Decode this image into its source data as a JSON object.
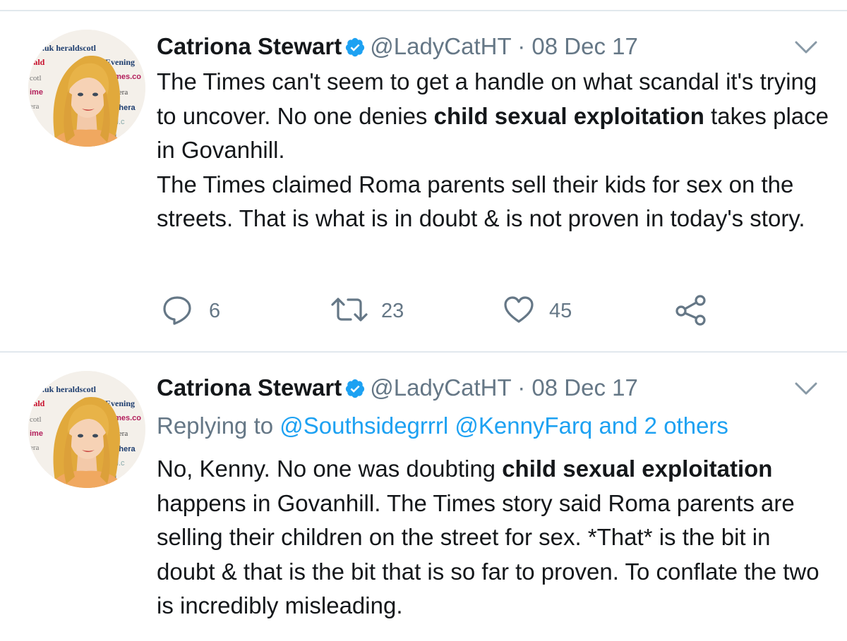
{
  "tweets": [
    {
      "author": {
        "name": "Catriona Stewart",
        "handle": "@LadyCatHT",
        "separator": "·",
        "date": "08 Dec 17",
        "verified": true
      },
      "text": {
        "p1_pre": "The Times can't seem to get a handle on what scandal it's trying to uncover. No one denies ",
        "p1_bold": "child sexual exploitation",
        "p1_post": " takes place in Govanhill.",
        "p2": "The Times claimed Roma parents sell their kids for sex on the streets. That is what is in doubt & is not proven in today's story."
      },
      "stats": {
        "replies": "6",
        "retweets": "23",
        "likes": "45"
      }
    },
    {
      "author": {
        "name": "Catriona Stewart",
        "handle": "@LadyCatHT",
        "separator": "·",
        "date": "08 Dec 17",
        "verified": true
      },
      "replying_to": {
        "prefix": "Replying to ",
        "mentions": "@Southsidegrrrl @KennyFarq and 2 others"
      },
      "text": {
        "p1_pre": "No, Kenny. No one was doubting ",
        "p1_bold": "child sexual exploitation",
        "p1_post": " happens in Govanhill. The Times story said Roma parents are selling their children on the street for sex. *That* is the bit in doubt & that is the bit that is so far to proven. To conflate the two is incredibly misleading."
      }
    }
  ],
  "avatar_background_text": [
    ".uk heraldscotl",
    "rald",
    "ld Evening",
    "cotl",
    "ingTimes.co",
    "ime",
    "The Hera",
    "era",
    "undayhera",
    "otland.c",
    "enin"
  ],
  "colors": {
    "text": "#14171a",
    "muted": "#657786",
    "link": "#1da1f2",
    "verified": "#1da1f2",
    "divider": "#e1e8ed"
  },
  "icons": [
    "verified-badge-icon",
    "chevron-down-icon",
    "reply-icon",
    "retweet-icon",
    "like-icon",
    "share-icon"
  ]
}
